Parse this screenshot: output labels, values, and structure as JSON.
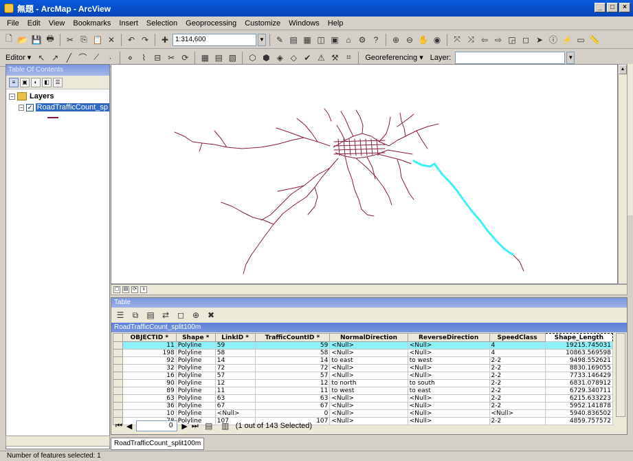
{
  "window": {
    "title": "無題 - ArcMap - ArcView",
    "min_icon": "_",
    "max_icon": "□",
    "close_icon": "×"
  },
  "menu": [
    "File",
    "Edit",
    "View",
    "Bookmarks",
    "Insert",
    "Selection",
    "Geoprocessing",
    "Customize",
    "Windows",
    "Help"
  ],
  "toolbar": {
    "scale": "1:314,600",
    "editor_label": "Editor ▾",
    "georeferencing_label": "Georeferencing ▾",
    "layer_label": "Layer:"
  },
  "toc": {
    "title": "Table Of Contents",
    "group_label": "Layers",
    "layer_name": "RoadTrafficCount_sp",
    "expander_group": "−",
    "expander_layer": "−",
    "checkbox_mark": "✓"
  },
  "map": {
    "road_color": "#8b1a3a",
    "selected_color": "#3df0f8"
  },
  "table": {
    "window_title": "Table",
    "table_name": "RoadTrafficCount_split100m",
    "columns": [
      "OBJECTID *",
      "Shape *",
      "LinkID *",
      "TrafficCountID *",
      "NormalDirection",
      "ReverseDirection",
      "SpeedClass",
      "Shape_Length"
    ],
    "rows": [
      [
        "11",
        "Polyline",
        "59",
        "59",
        "<Null>",
        "<Null>",
        "4",
        "19215.745031"
      ],
      [
        "198",
        "Polyline",
        "58",
        "58",
        "<Null>",
        "<Null>",
        "4",
        "10863.569598"
      ],
      [
        "92",
        "Polyline",
        "14",
        "14",
        "to east",
        "to west",
        "2-2",
        "9498.552621"
      ],
      [
        "32",
        "Polyline",
        "72",
        "72",
        "<Null>",
        "<Null>",
        "2-2",
        "8830.169055"
      ],
      [
        "16",
        "Polyline",
        "57",
        "57",
        "<Null>",
        "<Null>",
        "2-2",
        "7733.146429"
      ],
      [
        "90",
        "Polyline",
        "12",
        "12",
        "to north",
        "to south",
        "2-2",
        "6831.078912"
      ],
      [
        "89",
        "Polyline",
        "11",
        "11",
        "to west",
        "to east",
        "2-2",
        "6729.340711"
      ],
      [
        "63",
        "Polyline",
        "63",
        "63",
        "<Null>",
        "<Null>",
        "2-2",
        "6215.633223"
      ],
      [
        "36",
        "Polyline",
        "67",
        "67",
        "<Null>",
        "<Null>",
        "2-2",
        "5952.141878"
      ],
      [
        "10",
        "Polyline",
        "<Null>",
        "0",
        "<Null>",
        "<Null>",
        "<Null>",
        "5940.836502"
      ],
      [
        "78",
        "Polyline",
        "107",
        "107",
        "<Null>",
        "<Null>",
        "2-2",
        "4859.757572"
      ]
    ],
    "record_value": "0",
    "selection_text": "(1 out of 143 Selected)",
    "tab_label": "RoadTrafficCount_split100m"
  },
  "status": "Number of features selected: 1"
}
